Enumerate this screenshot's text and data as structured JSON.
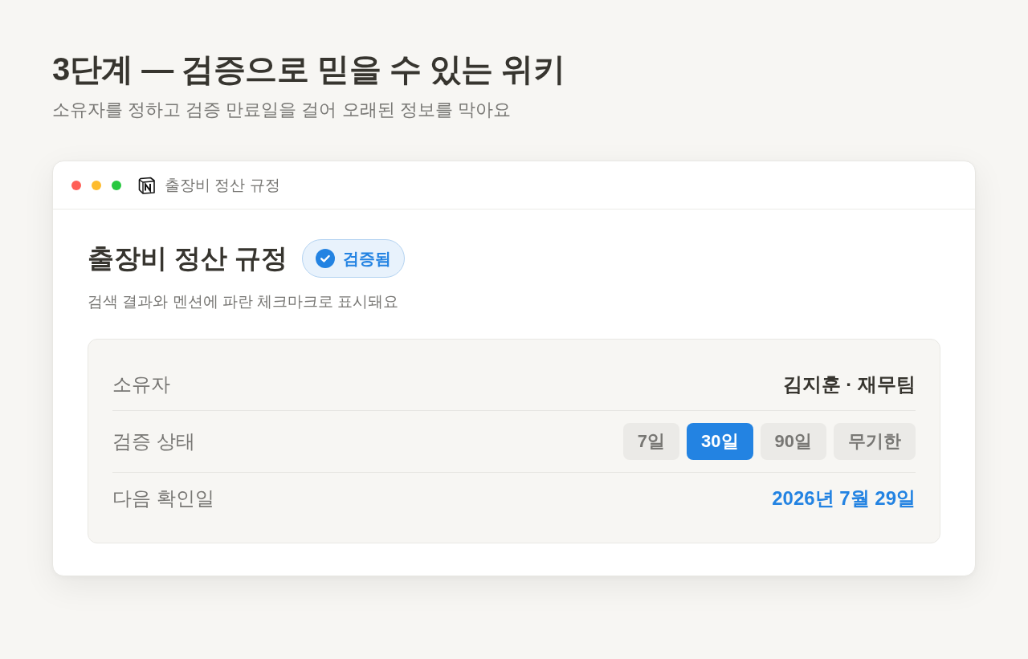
{
  "header": {
    "title": "3단계 — 검증으로 믿을 수 있는 위키",
    "subtitle": "소유자를 정하고 검증 만료일을 걸어 오래된 정보를 막아요"
  },
  "window": {
    "title": "출장비 정산 규정"
  },
  "page": {
    "title": "출장비 정산 규정",
    "badge": "검증됨",
    "description": "검색 결과와 멘션에 파란 체크마크로 표시돼요"
  },
  "properties": [
    {
      "kind": "person",
      "label": "소유자",
      "value": "김지훈 · 재무팀"
    },
    {
      "kind": "options",
      "label": "검증 상태",
      "options": [
        {
          "label": "7일",
          "selected": false
        },
        {
          "label": "30일",
          "selected": true
        },
        {
          "label": "90일",
          "selected": false
        },
        {
          "label": "무기한",
          "selected": false
        }
      ]
    },
    {
      "kind": "date",
      "label": "다음 확인일",
      "value": "2026년 7월 29일"
    }
  ]
}
